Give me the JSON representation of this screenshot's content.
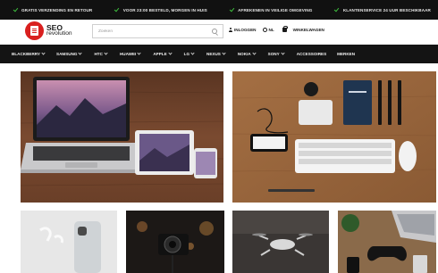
{
  "topbar": {
    "usps": [
      "GRATIS VERZENDING EN RETOUR",
      "VOOR 23:00 BESTELD, MORGEN IN HUIS",
      "AFREKENEN IN VEILIGE OMGEVING",
      "KLANTENSERVICE 24 UUR BESCHIKBAAR"
    ]
  },
  "header": {
    "logo_line1": "SEO",
    "logo_line2": "revolution",
    "search_placeholder": "Zoeken",
    "login": "INLOGGEN",
    "language": "NL",
    "cart": "WINKELWAGEN"
  },
  "nav": {
    "items": [
      {
        "label": "BLACKBERRY",
        "dropdown": true
      },
      {
        "label": "SAMSUNG",
        "dropdown": true
      },
      {
        "label": "HTC",
        "dropdown": true
      },
      {
        "label": "HUAWEI",
        "dropdown": true
      },
      {
        "label": "APPLE",
        "dropdown": true
      },
      {
        "label": "LG",
        "dropdown": true
      },
      {
        "label": "NEXUS",
        "dropdown": true
      },
      {
        "label": "NOKIA",
        "dropdown": true
      },
      {
        "label": "SONY",
        "dropdown": true
      },
      {
        "label": "ACCESSOIRES",
        "dropdown": false
      },
      {
        "label": "MERKEN",
        "dropdown": false
      }
    ]
  },
  "tiles": [
    {
      "name": "tile-macbook-ipad-iphone",
      "subject": "laptop-tablet-phone"
    },
    {
      "name": "tile-desk-accessories",
      "subject": "phone-keyboard-notebook-mouse"
    },
    {
      "name": "tile-iphone-airpods",
      "subject": "phone-earbuds"
    },
    {
      "name": "tile-camera",
      "subject": "camera"
    },
    {
      "name": "tile-drone",
      "subject": "drone"
    },
    {
      "name": "tile-gaming",
      "subject": "laptop-controller"
    }
  ],
  "colors": {
    "brand_red": "#d9201f",
    "topbar_bg": "#111111",
    "nav_bg": "#141414",
    "check_green": "#3fbf3f"
  }
}
